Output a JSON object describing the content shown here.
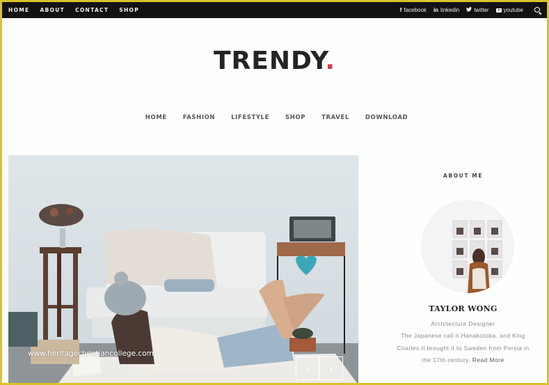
{
  "topbar": {
    "nav": [
      "HOME",
      "ABOUT",
      "CONTACT",
      "SHOP"
    ],
    "social": [
      {
        "icon": "facebook-icon",
        "glyph": "f",
        "label": "facebook"
      },
      {
        "icon": "linkedin-icon",
        "glyph": "in",
        "label": "linkedin"
      },
      {
        "icon": "twitter-icon",
        "glyph": "🐦",
        "label": "twitter"
      },
      {
        "icon": "youtube-icon",
        "glyph": "",
        "label": "youtube"
      }
    ],
    "search_icon": "search-icon"
  },
  "logo": {
    "text": "TRENDY",
    "dot": ".",
    "dot_color": "#d6394a"
  },
  "main_nav": [
    "HOME",
    "FASHION",
    "LIFESTYLE",
    "SHOP",
    "TRAVEL",
    "DOWNLOAD"
  ],
  "hero": {
    "watermark": "www.heritagechristiancollege.com",
    "prev_label": "‹",
    "next_label": "›"
  },
  "sidebar": {
    "title": "ABOUT ME",
    "name": "TAYLOR WONG",
    "role": "Architecture Designer",
    "bio": "The Japanese call it Hanakotoba, and King Charles II brought it to Sweden from Persia in the 17th century.",
    "read_more": "Read More"
  },
  "colors": {
    "frame": "#d9c22b",
    "topbar": "#141211",
    "accent": "#d6394a"
  }
}
